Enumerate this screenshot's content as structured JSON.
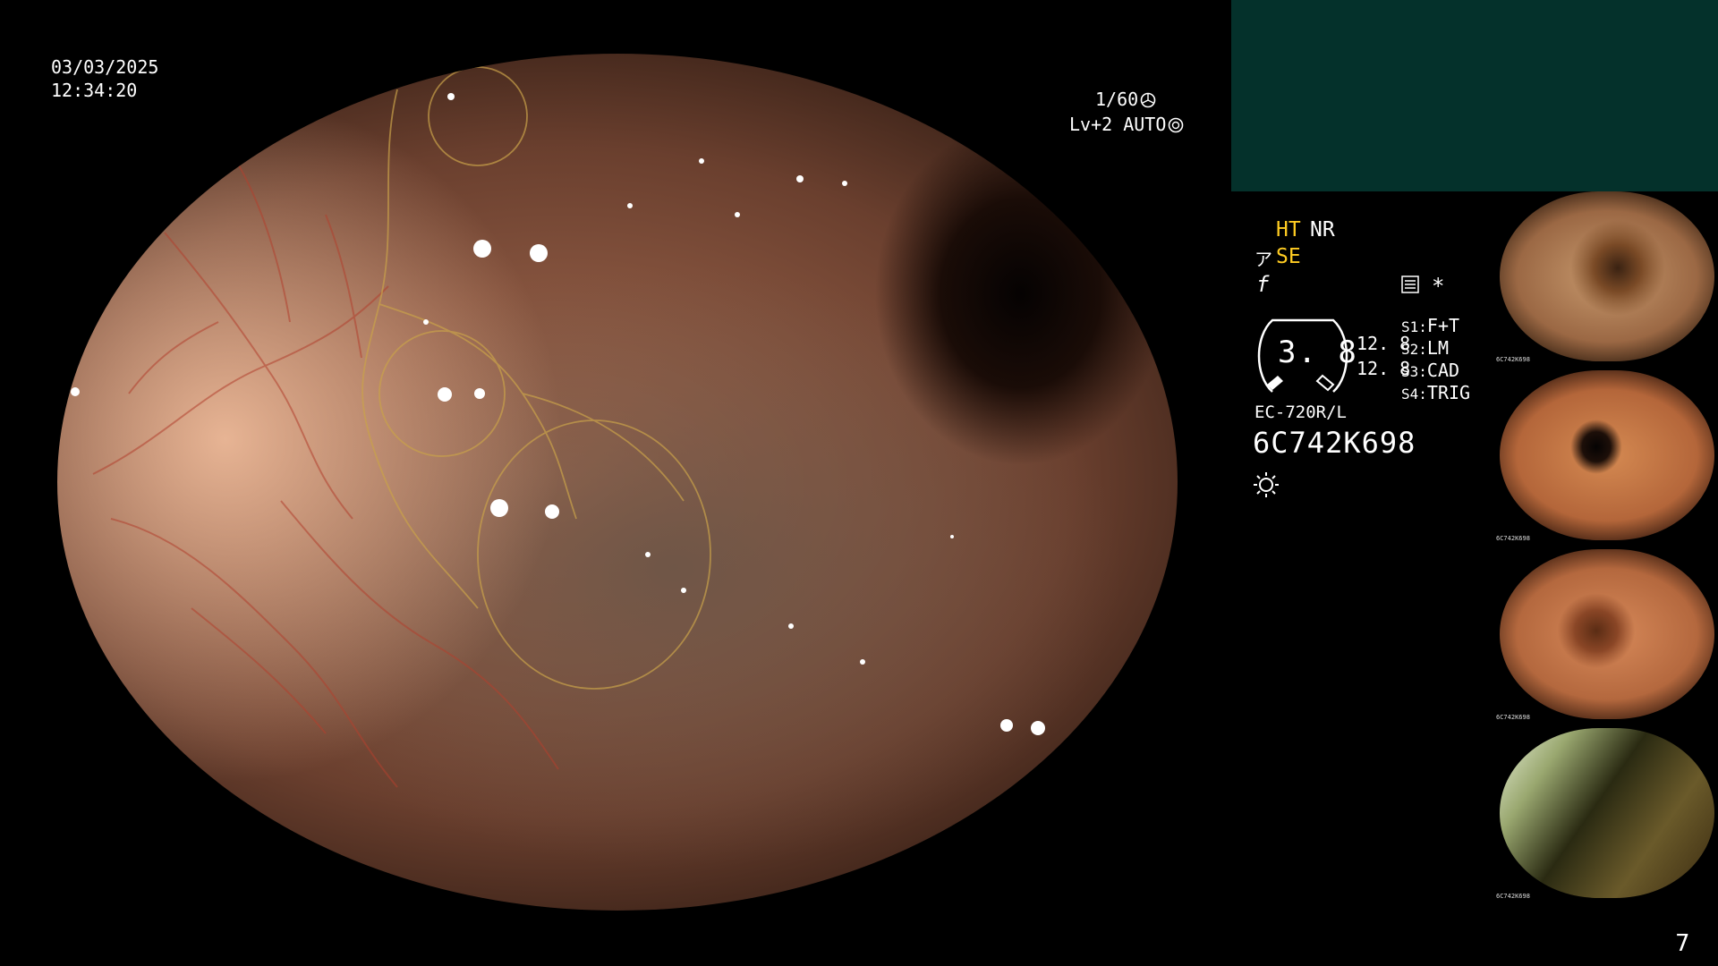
{
  "overlay": {
    "date": "03/03/2025",
    "time": "12:34:20",
    "shutter": "1/60",
    "level": "Lv+2 AUTO"
  },
  "panel": {
    "ht": "HT",
    "nr": "NR",
    "se": "SE",
    "se_symbol": "ア",
    "f_symbol": "f",
    "star": "*",
    "dial_value": "3. 8",
    "numbers": [
      "12. 8",
      "12. 8"
    ],
    "settings": [
      {
        "key": "S1:",
        "value": "F+T"
      },
      {
        "key": "S2:",
        "value": "LM"
      },
      {
        "key": "S3:",
        "value": "CAD"
      },
      {
        "key": "S4:",
        "value": "TRIG"
      }
    ],
    "scope_model": "EC-720R/L",
    "serial": "6C742K698",
    "colors": {
      "yellow": "#ffcc22",
      "teal_block": "#04312b"
    },
    "icons": [
      "shutter-icon",
      "auto-iris-icon",
      "menu-icon",
      "star-icon",
      "light-icon"
    ]
  },
  "thumbnails": [
    {
      "serial": "6C742K698"
    },
    {
      "serial": "6C742K698"
    },
    {
      "serial": "6C742K698"
    },
    {
      "serial": "6C742K698"
    }
  ],
  "page_number": "7"
}
